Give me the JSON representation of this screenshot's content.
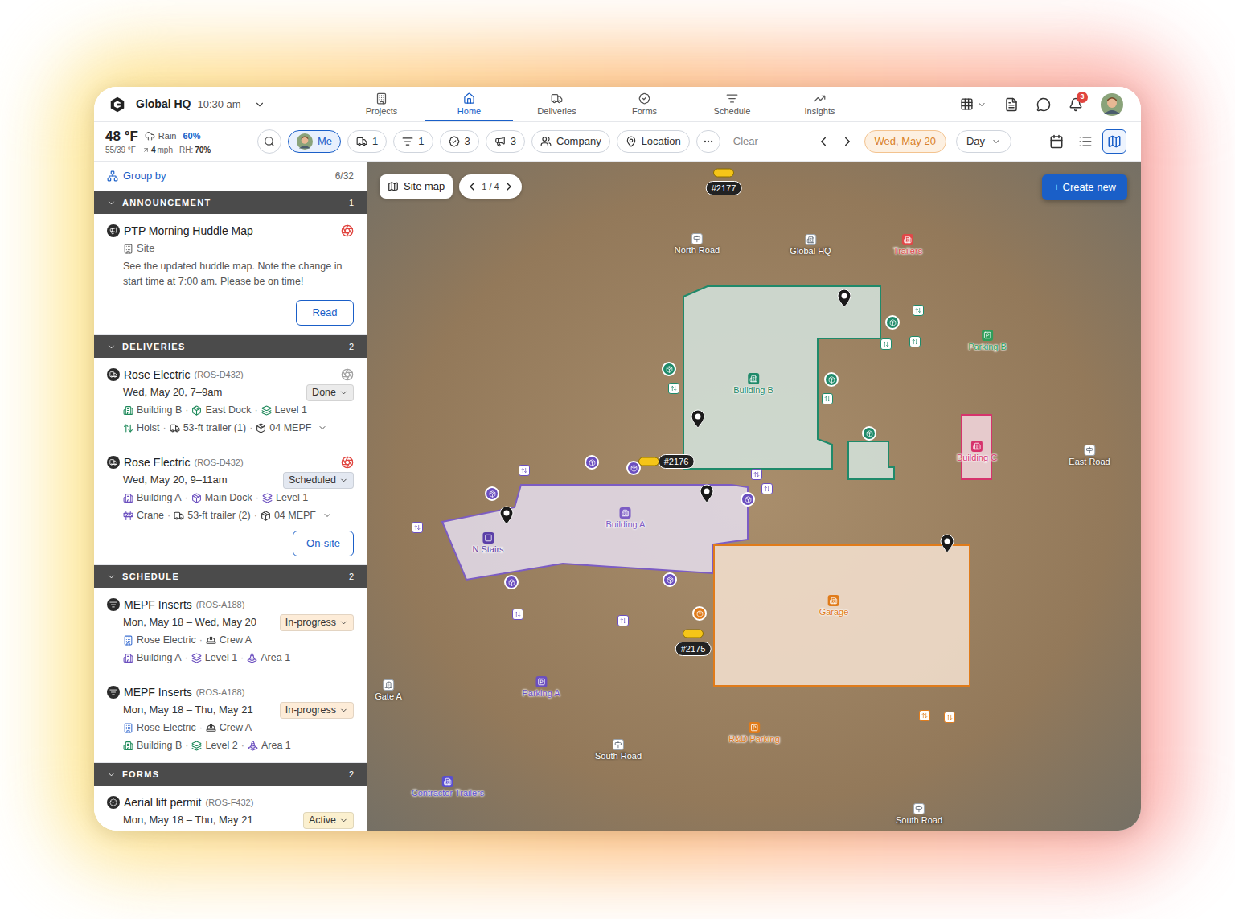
{
  "top_nav": {
    "org": "Global HQ",
    "time": "10:30 am",
    "tabs": [
      {
        "label": "Projects",
        "selected": false
      },
      {
        "label": "Home",
        "selected": true
      },
      {
        "label": "Deliveries",
        "selected": false
      },
      {
        "label": "Forms",
        "selected": false
      },
      {
        "label": "Schedule",
        "selected": false
      },
      {
        "label": "Insights",
        "selected": false
      }
    ],
    "notifications": "3"
  },
  "filter_bar": {
    "weather": {
      "temp": "48 °F",
      "condition": "Rain",
      "chance": "60%",
      "range": "55/39 °F",
      "wind": "4",
      "wind_unit": "mph",
      "humidity_label": "RH:",
      "humidity": "70%"
    },
    "filters": [
      {
        "kind": "user",
        "label": "Me",
        "selected": true
      },
      {
        "kind": "deliveries",
        "label": "1",
        "selected": false
      },
      {
        "kind": "schedule",
        "label": "1",
        "selected": false
      },
      {
        "kind": "forms",
        "label": "3",
        "selected": false
      },
      {
        "kind": "announcements",
        "label": "3",
        "selected": false
      },
      {
        "kind": "company",
        "label": "Company",
        "selected": false
      },
      {
        "kind": "location",
        "label": "Location",
        "selected": false
      }
    ],
    "clear": "Clear",
    "date": "Wed, May 20",
    "range": "Day",
    "views": [
      {
        "kind": "calendar",
        "selected": false
      },
      {
        "kind": "list",
        "selected": false
      },
      {
        "kind": "map",
        "selected": true
      }
    ]
  },
  "panel": {
    "group_by": "Group by",
    "count": "6/32",
    "separator": "·",
    "sections": [
      {
        "title": "ANNOUNCEMENT",
        "count": "1",
        "expanded": true,
        "items": [
          {
            "kind": "announcement",
            "title": "PTP Morning Huddle Map",
            "location": "Site",
            "body": "See the updated huddle map. Note the change in start time at 7:00 am. Please be on time!",
            "button": "Read",
            "indicator_color": "#e0443e"
          }
        ]
      },
      {
        "title": "DELIVERIES",
        "count": "2",
        "expanded": true,
        "items": [
          {
            "kind": "delivery",
            "title": "Rose Electric",
            "code": "(ROS-D432)",
            "when": "Wed, May 20, 7–9am",
            "status": {
              "label": "Done",
              "color": "#ebebeb"
            },
            "indicator_color": "#a3a3a3",
            "tags_expanded": false,
            "tags": [
              [
                {
                  "label": "Building B",
                  "kind": "building",
                  "color": "#1f8a5b"
                },
                {
                  "label": "East Dock",
                  "kind": "dock",
                  "color": "#1f8a5b"
                },
                {
                  "label": "Level 1",
                  "kind": "level",
                  "color": "#1f8a5b"
                }
              ],
              [
                {
                  "label": "Hoist",
                  "kind": "hoist",
                  "color": "#1f8a5b"
                },
                {
                  "label": "53-ft trailer (1)",
                  "kind": "trailer",
                  "color": "#3a3a3a"
                },
                {
                  "label": "04 MEPF",
                  "kind": "package",
                  "color": "#3a3a3a"
                }
              ]
            ]
          },
          {
            "kind": "delivery",
            "title": "Rose Electric",
            "code": "(ROS-D432)",
            "when": "Wed, May 20, 9–11am",
            "status": {
              "label": "Scheduled",
              "color": "#e3e8f1"
            },
            "indicator_color": "#e0443e",
            "tags_expanded": false,
            "button": "On-site",
            "tags": [
              [
                {
                  "label": "Building A",
                  "kind": "building",
                  "color": "#6b4fbf"
                },
                {
                  "label": "Main Dock",
                  "kind": "dock",
                  "color": "#6b4fbf"
                },
                {
                  "label": "Level 1",
                  "kind": "level",
                  "color": "#6b4fbf"
                }
              ],
              [
                {
                  "label": "Crane",
                  "kind": "crane",
                  "color": "#6b4fbf"
                },
                {
                  "label": "53-ft trailer (2)",
                  "kind": "trailer",
                  "color": "#3a3a3a"
                },
                {
                  "label": "04 MEPF",
                  "kind": "package",
                  "color": "#3a3a3a"
                }
              ]
            ]
          }
        ]
      },
      {
        "title": "SCHEDULE",
        "count": "2",
        "expanded": true,
        "items": [
          {
            "kind": "schedule",
            "title": "MEPF Inserts",
            "code": "(ROS-A188)",
            "when": "Mon, May 18 – Wed, May 20",
            "status": {
              "label": "In-progress",
              "color": "#fdecd8"
            },
            "tags": [
              [
                {
                  "label": "Rose Electric",
                  "kind": "company",
                  "color": "#3b6fd1"
                },
                {
                  "label": "Crew A",
                  "kind": "crew",
                  "color": "#3a3a3a"
                }
              ],
              [
                {
                  "label": "Building A",
                  "kind": "building",
                  "color": "#6b4fbf"
                },
                {
                  "label": "Level 1",
                  "kind": "level",
                  "color": "#6b4fbf"
                },
                {
                  "label": "Area 1",
                  "kind": "area",
                  "color": "#6b4fbf"
                }
              ]
            ]
          },
          {
            "kind": "schedule",
            "title": "MEPF Inserts",
            "code": "(ROS-A188)",
            "when": "Mon, May 18 – Thu, May 21",
            "status": {
              "label": "In-progress",
              "color": "#fdecd8"
            },
            "tags": [
              [
                {
                  "label": "Rose Electric",
                  "kind": "company",
                  "color": "#3b6fd1"
                },
                {
                  "label": "Crew A",
                  "kind": "crew",
                  "color": "#3a3a3a"
                }
              ],
              [
                {
                  "label": "Building B",
                  "kind": "building",
                  "color": "#1f8a5b"
                },
                {
                  "label": "Level 2",
                  "kind": "level",
                  "color": "#1f8a5b"
                },
                {
                  "label": "Area 1",
                  "kind": "area",
                  "color": "#6b4fbf"
                }
              ]
            ]
          }
        ]
      },
      {
        "title": "FORMS",
        "count": "2",
        "expanded": true,
        "items": [
          {
            "kind": "form",
            "title": "Aerial lift permit",
            "code": "(ROS-F432)",
            "when": "Mon, May 18 – Thu, May 21",
            "status": {
              "label": "Active",
              "color": "#fbf0cf"
            }
          }
        ]
      }
    ]
  },
  "map": {
    "site_map_button": "Site map",
    "page": "1 / 4",
    "create_button": "+ Create new",
    "zones": [
      {
        "label": "Building B",
        "color": "#1f8a6a"
      },
      {
        "color": "#1f8a6a"
      },
      {
        "label": "Building C",
        "color": "#d6336c"
      },
      {
        "label": "Building A",
        "color": "#7c5cc4"
      },
      {
        "label": "Garage",
        "color": "#e07b1a"
      }
    ],
    "places": [
      {
        "label": "North Road",
        "kind": "road",
        "color": "#ffffff"
      },
      {
        "label": "Global HQ",
        "kind": "hq",
        "color": "#ffffff"
      },
      {
        "label": "Trailers",
        "kind": "trailers",
        "color": "#e04848"
      },
      {
        "label": "Parking B",
        "kind": "parking",
        "color": "#2e9e5a"
      },
      {
        "label": "East Road",
        "kind": "road",
        "color": "#ffffff"
      },
      {
        "label": "N Stairs",
        "kind": "stairs",
        "color": "#5b3fa8"
      },
      {
        "label": "Parking A",
        "kind": "parking",
        "color": "#6b4fbf"
      },
      {
        "label": "R&D Parking",
        "kind": "parking",
        "color": "#e07b1a"
      },
      {
        "label": "Gate A",
        "kind": "gate",
        "color": "#ffffff"
      },
      {
        "label": "South Road",
        "kind": "road",
        "color": "#ffffff"
      },
      {
        "label": "Contractor Trailers",
        "kind": "trailers",
        "color": "#5a4fcf"
      },
      {
        "label": "South Road",
        "kind": "road",
        "color": "#ffffff"
      }
    ],
    "vehicles": [
      {
        "label": "#2177"
      },
      {
        "label": "#2176"
      },
      {
        "label": "#2175"
      }
    ],
    "markers": [
      {
        "kind": "pin",
        "color": "#1a1a1a"
      },
      {
        "kind": "pin",
        "color": "#1a1a1a"
      },
      {
        "kind": "pin",
        "color": "#1a1a1a"
      },
      {
        "kind": "pin",
        "color": "#1a1a1a"
      },
      {
        "kind": "pin",
        "color": "#1a1a1a"
      },
      {
        "kind": "circle",
        "color": "#6b4fbf"
      },
      {
        "kind": "circle",
        "color": "#6b4fbf"
      },
      {
        "kind": "circle",
        "color": "#6b4fbf"
      },
      {
        "kind": "circle",
        "color": "#6b4fbf"
      },
      {
        "kind": "circle",
        "color": "#6b4fbf"
      },
      {
        "kind": "circle",
        "color": "#6b4fbf"
      },
      {
        "kind": "circle",
        "color": "#1f8a6a"
      },
      {
        "kind": "circle",
        "color": "#1f8a6a"
      },
      {
        "kind": "circle",
        "color": "#1f8a6a"
      },
      {
        "kind": "circle",
        "color": "#1f8a6a"
      },
      {
        "kind": "square",
        "color": "#1f8a6a"
      },
      {
        "kind": "square",
        "color": "#1f8a6a"
      },
      {
        "kind": "square",
        "color": "#1f8a6a"
      },
      {
        "kind": "square",
        "color": "#1f8a6a"
      },
      {
        "kind": "square",
        "color": "#1f8a6a"
      },
      {
        "kind": "square",
        "color": "#6b4fbf"
      },
      {
        "kind": "square",
        "color": "#6b4fbf"
      },
      {
        "kind": "square",
        "color": "#6b4fbf"
      },
      {
        "kind": "square",
        "color": "#6b4fbf"
      },
      {
        "kind": "square",
        "color": "#6b4fbf"
      },
      {
        "kind": "square",
        "color": "#6b4fbf"
      },
      {
        "kind": "circle",
        "color": "#e07b1a"
      },
      {
        "kind": "square",
        "color": "#e07b1a"
      },
      {
        "kind": "square",
        "color": "#e07b1a"
      }
    ]
  }
}
